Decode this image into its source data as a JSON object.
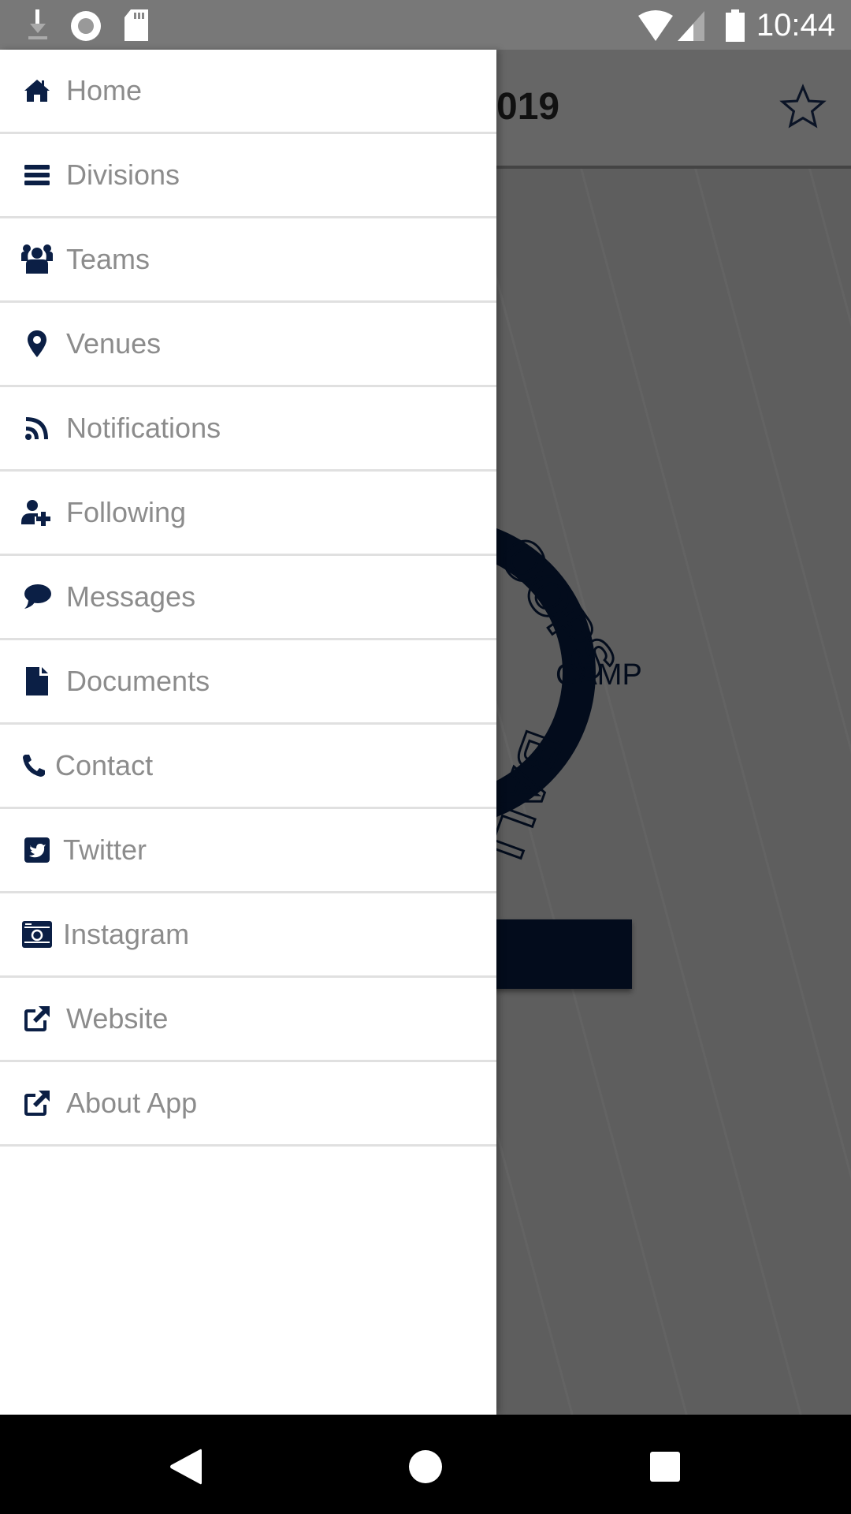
{
  "status_bar": {
    "time": "10:44",
    "left_icons": [
      "download-icon",
      "sync-icon",
      "sd-card-icon"
    ],
    "right_icons": [
      "wifi-icon",
      "signal-icon",
      "battery-icon"
    ]
  },
  "app": {
    "title_partial": "019",
    "favorite_icon": "star-outline-icon",
    "logo_text": {
      "camp": "CAMP",
      "arc_top": "OOPS",
      "arc_bottom": "BALL"
    }
  },
  "drawer": {
    "items": [
      {
        "label": "Home",
        "icon": "home-icon"
      },
      {
        "label": "Divisions",
        "icon": "bars-icon"
      },
      {
        "label": "Teams",
        "icon": "users-icon"
      },
      {
        "label": "Venues",
        "icon": "map-marker-icon"
      },
      {
        "label": "Notifications",
        "icon": "rss-icon"
      },
      {
        "label": "Following",
        "icon": "user-plus-icon"
      },
      {
        "label": "Messages",
        "icon": "comment-icon"
      },
      {
        "label": "Documents",
        "icon": "file-icon"
      },
      {
        "label": "Contact",
        "icon": "phone-icon"
      },
      {
        "label": "Twitter",
        "icon": "twitter-icon"
      },
      {
        "label": "Instagram",
        "icon": "instagram-icon"
      },
      {
        "label": "Website",
        "icon": "external-link-icon"
      },
      {
        "label": "About App",
        "icon": "external-link-icon"
      }
    ]
  },
  "nav_bar": {
    "buttons": [
      "back",
      "home",
      "recents"
    ]
  },
  "colors": {
    "icon": "#0b1f45",
    "label": "#8c8c8c",
    "divider": "#e0e0e0"
  }
}
